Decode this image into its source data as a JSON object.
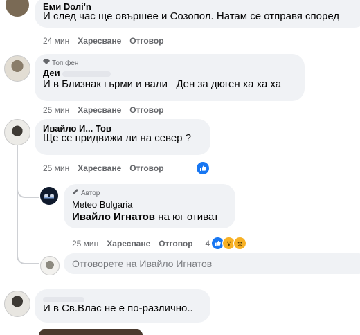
{
  "comments": [
    {
      "author_partial": "Eми Dолi'n",
      "text": "И след час ще овършее и Созопол. Натам се отправя според",
      "time": "24 мин",
      "like_label": "Харесване",
      "reply_label": "Отговор"
    },
    {
      "badge": "Топ фен",
      "author_partial": "Деи",
      "text": "И в Близнак гърми и вали_ Ден за дюген ха ха ха",
      "time": "25 мин",
      "like_label": "Харесване",
      "reply_label": "Отговор"
    },
    {
      "author_partial": "Ивайло И... Тов",
      "text": "Ще се придвижи ли на север ?",
      "time": "25 мин",
      "like_label": "Харесване",
      "reply_label": "Отговор"
    },
    {
      "badge": "Автор",
      "author": "Meteo Bulgaria",
      "mention": "Ивайло Игнатов",
      "text": " на юг отиват",
      "time": "25 мин",
      "like_label": "Харесване",
      "reply_label": "Отговор",
      "reaction_count": "4"
    },
    {
      "text": "И в Св.Влас не е по-различно..",
      "author_partial": ""
    }
  ],
  "reply_input": {
    "placeholder": "Отговорете на Ивайло Игнатов"
  },
  "colors": {
    "bubble": "#f0f2f5",
    "meta": "#65676b",
    "accent": "#1877f2"
  }
}
